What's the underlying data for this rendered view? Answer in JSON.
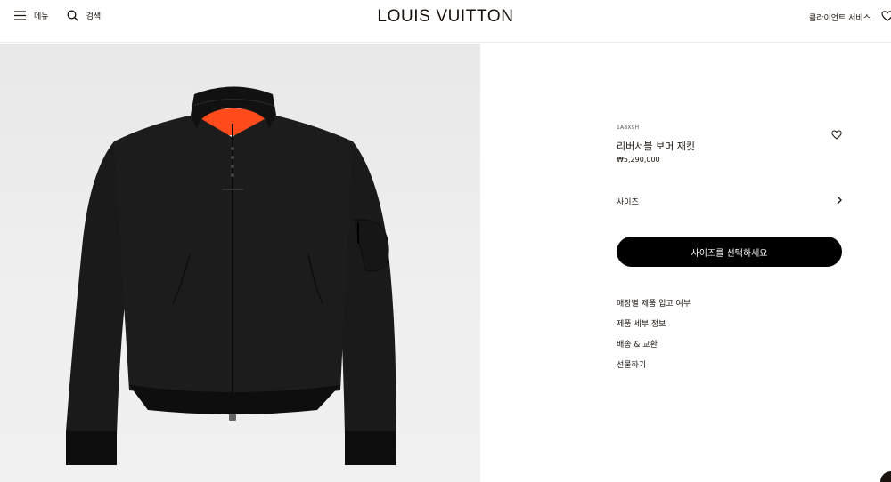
{
  "header": {
    "menu_label": "메뉴",
    "search_label": "검색",
    "brand": "LOUIS VUITTON",
    "client_service": "클라이언트 서비스"
  },
  "icons": {
    "menu": "hamburger-menu-icon",
    "search": "search-icon",
    "wishlist": "heart-icon",
    "size_chevron": "chevron-right-icon"
  },
  "product": {
    "sku": "1A8X9H",
    "name": "리버서블 보머 재킷",
    "price": "₩5,290,000",
    "size_label": "사이즈",
    "cta_label": "사이즈를 선택하세요",
    "info_links": [
      "매장별 제품 입고 여부",
      "제품 세부 정보",
      "배송 & 교환",
      "선물하기"
    ]
  },
  "colors": {
    "text": "#19110b",
    "button": "#000000",
    "gallery_bg": "#ececec",
    "jacket": "#1b1b1b",
    "lining": "#ff4a1c"
  }
}
